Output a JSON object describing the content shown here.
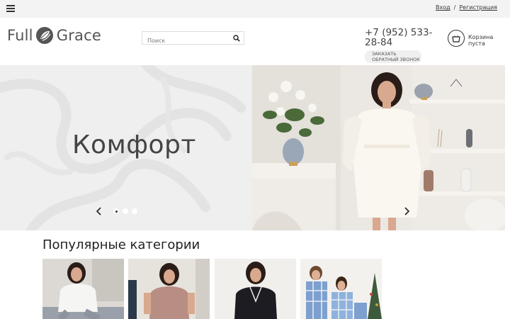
{
  "topbar": {
    "menu_icon": "hamburger-icon",
    "login_label": "Вход",
    "separator": "/",
    "register_label": "Регистрация"
  },
  "header": {
    "logo_word1": "Full",
    "logo_word2": "Grace",
    "logo_icon": "leaf-circle-icon",
    "search_placeholder": "Поиск",
    "search_icon": "search-icon",
    "phone": "+7 (952) 533-28-84",
    "callback_label": "ЗАКАЗАТЬ ОБРАТНЫЙ ЗВОНОК",
    "cart_icon": "basket-icon",
    "cart_label": "Корзина пуста"
  },
  "hero": {
    "title": "Комфорт",
    "prev_icon": "chevron-left-icon",
    "next_icon": "chevron-right-icon",
    "slides_count": 3,
    "active_slide": 1
  },
  "categories": {
    "title": "Популярные категории",
    "items": [
      {
        "image": "woman-white-sweatshirt"
      },
      {
        "image": "woman-pink-top"
      },
      {
        "image": "woman-black-pajamas"
      },
      {
        "image": "couple-plaid-pajamas"
      }
    ]
  },
  "colors": {
    "topbar_bg": "#f3f3f3",
    "hero_bg": "#efefef",
    "text_dark": "#333333"
  }
}
